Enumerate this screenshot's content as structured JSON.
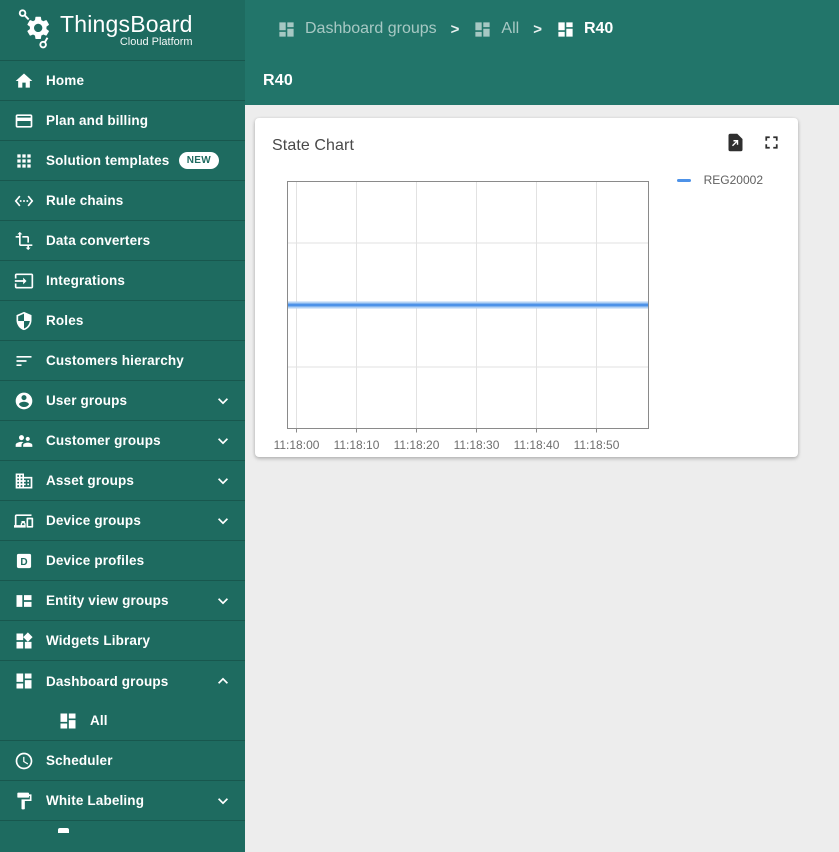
{
  "app": {
    "name": "ThingsBoard",
    "subtitle": "Cloud Platform"
  },
  "breadcrumb": {
    "separator": ">",
    "items": [
      {
        "label": "Dashboard groups",
        "icon": "dashboard-icon",
        "active": false
      },
      {
        "label": "All",
        "icon": "dashboard-icon",
        "active": false
      },
      {
        "label": "R40",
        "icon": "dashboard-icon",
        "active": true
      }
    ]
  },
  "page": {
    "title": "R40"
  },
  "sidebar": {
    "items": [
      {
        "label": "Home",
        "icon": "home"
      },
      {
        "label": "Plan and billing",
        "icon": "credit-card"
      },
      {
        "label": "Solution templates",
        "icon": "apps",
        "badge": "NEW"
      },
      {
        "label": "Rule chains",
        "icon": "rule-chains"
      },
      {
        "label": "Data converters",
        "icon": "transform"
      },
      {
        "label": "Integrations",
        "icon": "input"
      },
      {
        "label": "Roles",
        "icon": "shield"
      },
      {
        "label": "Customers hierarchy",
        "icon": "sort"
      },
      {
        "label": "User groups",
        "icon": "account-circle",
        "chevron": "down"
      },
      {
        "label": "Customer groups",
        "icon": "people",
        "chevron": "down"
      },
      {
        "label": "Asset groups",
        "icon": "domain",
        "chevron": "down"
      },
      {
        "label": "Device groups",
        "icon": "devices",
        "chevron": "down"
      },
      {
        "label": "Device profiles",
        "icon": "device-profile"
      },
      {
        "label": "Entity view groups",
        "icon": "view-quilt",
        "chevron": "down"
      },
      {
        "label": "Widgets Library",
        "icon": "widgets"
      },
      {
        "label": "Dashboard groups",
        "icon": "dashboard",
        "chevron": "up"
      },
      {
        "label": "All",
        "icon": "dashboard",
        "indent": true
      },
      {
        "label": "Scheduler",
        "icon": "schedule"
      },
      {
        "label": "White Labeling",
        "icon": "format-paint",
        "chevron": "down"
      }
    ]
  },
  "widget": {
    "title": "State Chart",
    "actions": [
      {
        "name": "export-image",
        "icon": "file-export"
      },
      {
        "name": "fullscreen",
        "icon": "fullscreen"
      }
    ]
  },
  "chart_data": {
    "type": "line",
    "title": "State Chart",
    "x_ticks": [
      "11:18:00",
      "11:18:10",
      "11:18:20",
      "11:18:30",
      "11:18:40",
      "11:18:50"
    ],
    "x_tick_interval_seconds": 10,
    "y_axis": {
      "labels_visible": false,
      "gridline_fractions": [
        0.25,
        0.5,
        0.75
      ]
    },
    "grid": true,
    "legend": {
      "position": "top-right",
      "entries": [
        "REG20002"
      ]
    },
    "series": [
      {
        "name": "REG20002",
        "color": "#4D92E8",
        "halo_color": "#B3D2F4",
        "shape": "constant-horizontal-line",
        "y_fraction_from_top": 0.5
      }
    ]
  },
  "colors": {
    "sidebar_bg": "#1E6B60",
    "header_bg": "#22756A",
    "content_bg": "#EDEDED",
    "accent_blue": "#4D92E8",
    "chart_border": "#8A8A8A",
    "chart_grid": "#E2E2E2",
    "axis_label": "#6E6E6E"
  }
}
